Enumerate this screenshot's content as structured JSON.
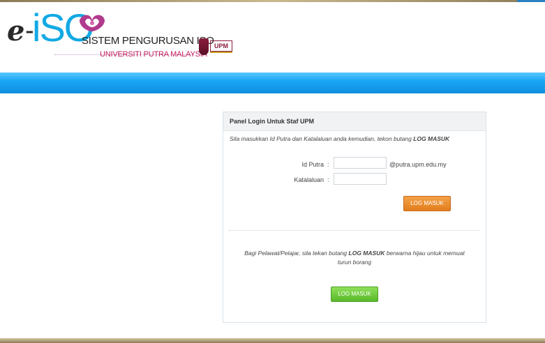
{
  "header": {
    "logo_e": "e",
    "logo_dash": "-",
    "logo_iso": "iSO",
    "system_name": "SISTEM PENGURUSAN ISO",
    "university": "UNIVERSITI PUTRA MALAYSIA",
    "badge": "UPM"
  },
  "colors": {
    "accent_blue": "#1aa6f5",
    "staff_button": "#e27d1c",
    "guest_button": "#58b82a",
    "university_text": "#c2185b"
  },
  "panel": {
    "title": "Panel Login Untuk Staf UPM",
    "instruction_prefix": "Sila masukkan Id Putra dan Katalaluan anda kemudian, tekon butang ",
    "instruction_emphasis": "LOG MASUK",
    "id_label": "Id Putra",
    "password_label": "Katalaluan",
    "colon": ":",
    "id_value": "",
    "password_value": "",
    "email_suffix": "@putra.upm.edu.my",
    "staff_login_button": "LOG MASUK",
    "guest_prefix": "Bagi Pelawat/Pelajar, sila tekan butang ",
    "guest_emphasis": "LOG MASUK",
    "guest_suffix": " berwarna hijau untuk memuat turun borang",
    "guest_login_button": "LOG MASUK"
  }
}
